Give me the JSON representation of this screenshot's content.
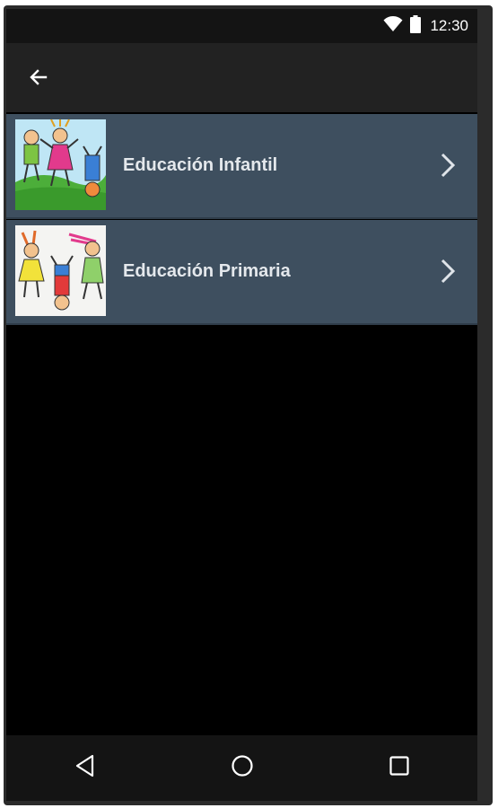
{
  "status_bar": {
    "time": "12:30",
    "icons": [
      "wifi-icon",
      "battery-icon"
    ]
  },
  "app_bar": {
    "back_icon": "back-arrow-icon"
  },
  "list": {
    "items": [
      {
        "label": "Educación Infantil",
        "thumbnail": "kids-drawing-infantil",
        "chevron": "chevron-right-icon"
      },
      {
        "label": "Educación Primaria",
        "thumbnail": "kids-drawing-primaria",
        "chevron": "chevron-right-icon"
      }
    ]
  },
  "nav_bar": {
    "buttons": [
      "back-triangle-icon",
      "home-circle-icon",
      "recents-square-icon"
    ]
  },
  "colors": {
    "list_item_bg": "#3e4f5f",
    "app_bar_bg": "#222222",
    "status_bar_bg": "#141414",
    "screen_bg": "#000000"
  }
}
